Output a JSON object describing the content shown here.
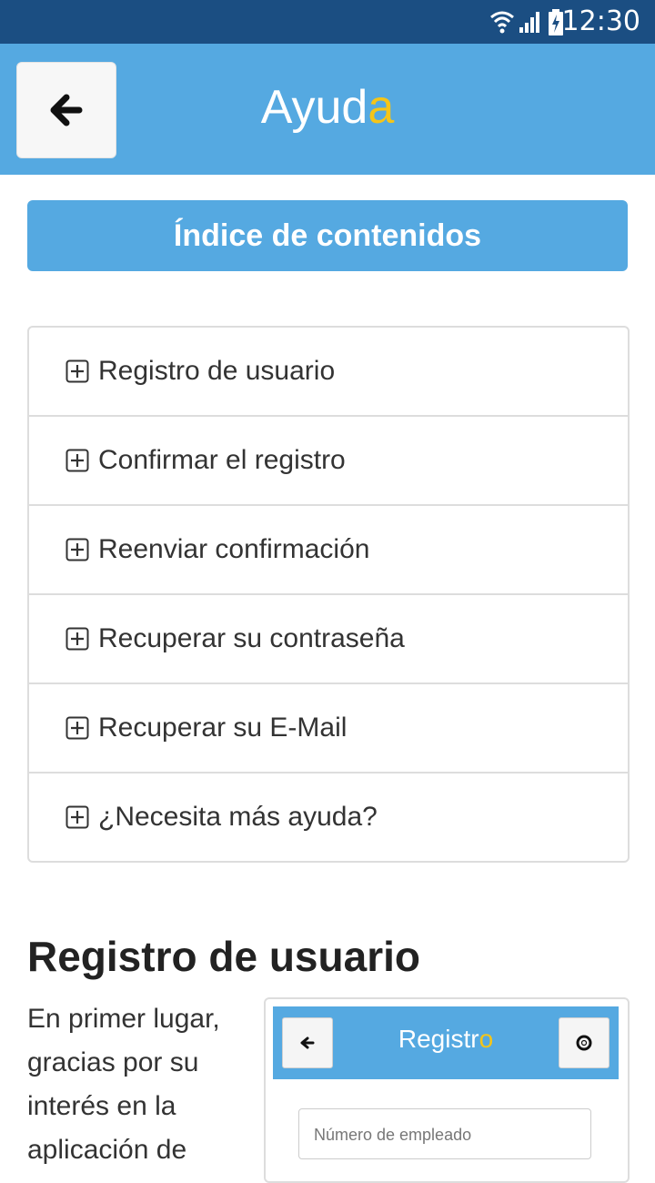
{
  "status_bar": {
    "time": "12:30",
    "icons": [
      "wifi-icon",
      "signal-icon",
      "battery-charging-icon"
    ]
  },
  "header": {
    "back_icon": "arrow-left-icon",
    "title_main": "Ayud",
    "title_accent": "a"
  },
  "index_banner": {
    "label": "Índice de contenidos"
  },
  "accordion": {
    "expand_icon": "plus-square-icon",
    "items": [
      {
        "label": "Registro de usuario"
      },
      {
        "label": "Confirmar el registro"
      },
      {
        "label": "Reenviar confirmación"
      },
      {
        "label": "Recuperar su contraseña"
      },
      {
        "label": "Recuperar su E-Mail"
      },
      {
        "label": "¿Necesita más ayuda?"
      }
    ]
  },
  "section": {
    "title": "Registro de usuario",
    "text": "En primer lugar, gracias por su interés en la aplicación de"
  },
  "embedded_screenshot": {
    "title_main": "Registr",
    "title_accent": "o",
    "input_placeholder": "Número de empleado",
    "left_icon": "arrow-left-icon",
    "right_icon": "lifebuoy-icon"
  },
  "colors": {
    "status_bar": "#1b4e82",
    "primary": "#55a9e1",
    "accent": "#f5c518"
  }
}
